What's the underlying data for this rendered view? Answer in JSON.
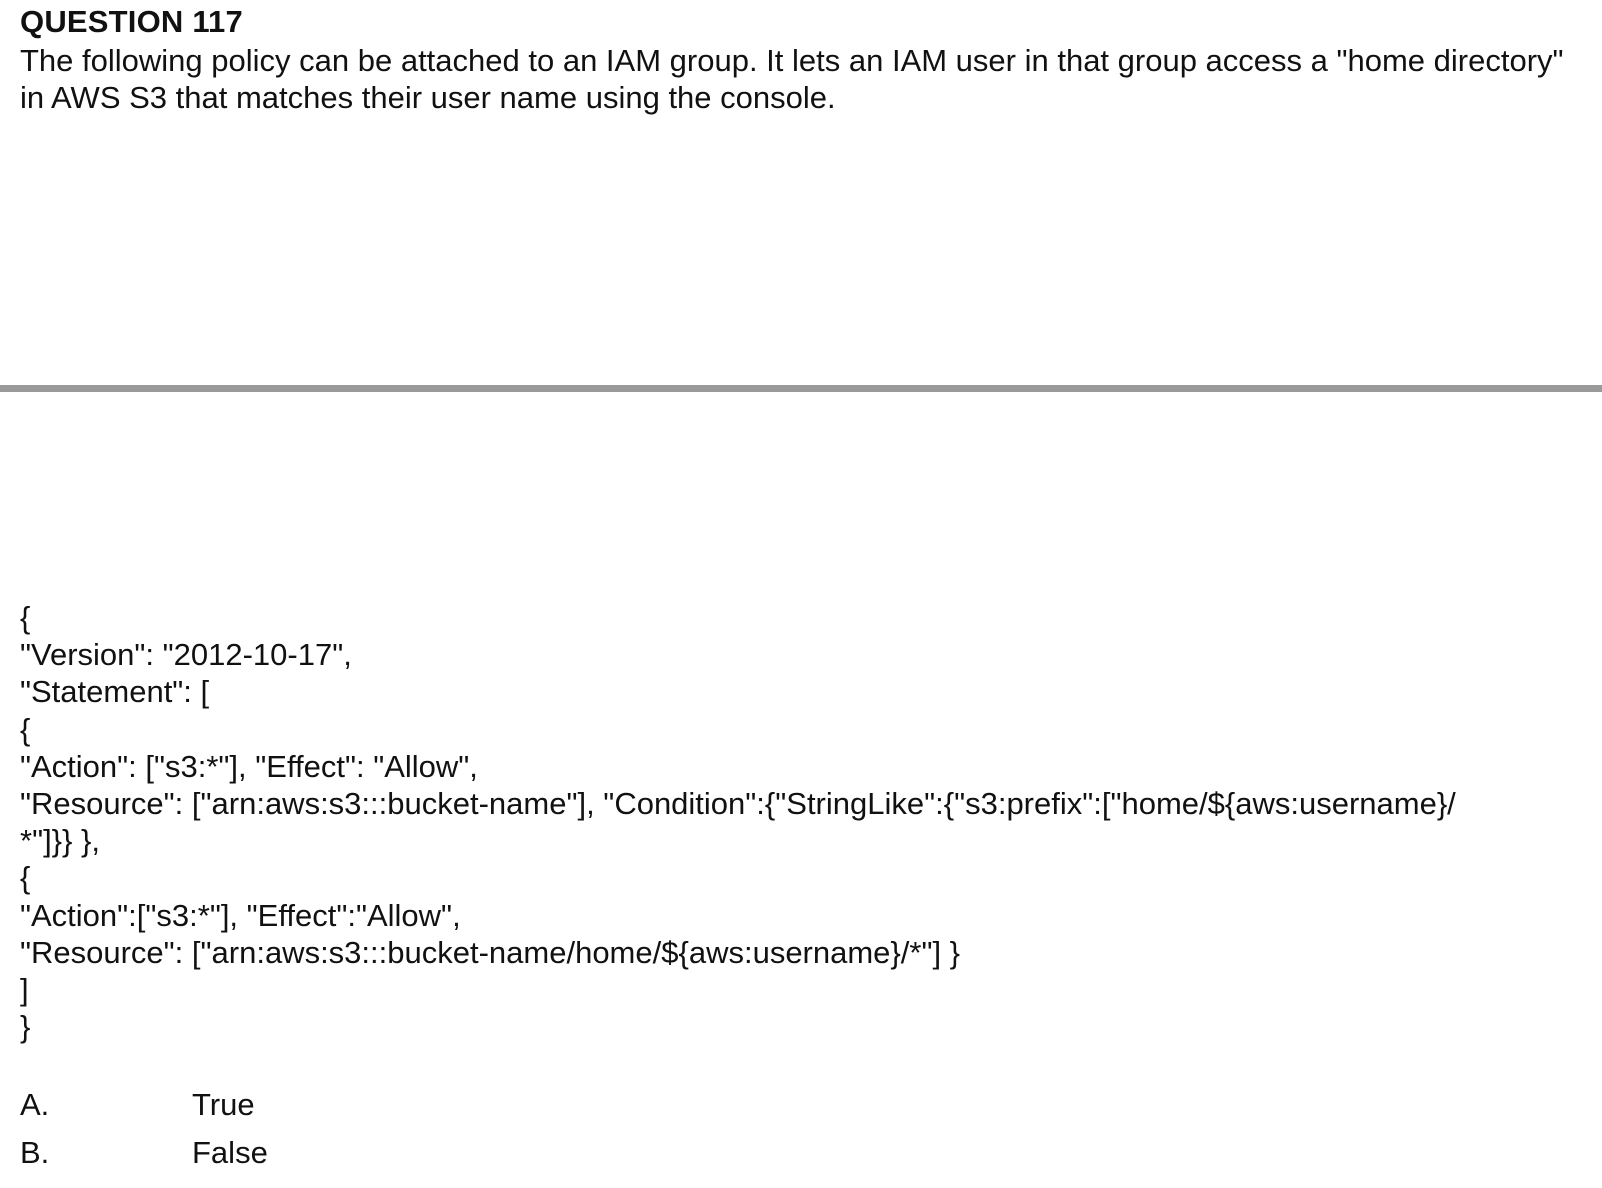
{
  "question": {
    "title": "QUESTION 117",
    "text": "The following policy can be attached to an IAM group. It lets an IAM user in that group access a \"home directory\" in AWS S3 that matches their user name using the console."
  },
  "policy_lines": [
    "{",
    "\"Version\": \"2012-10-17\",",
    "\"Statement\": [",
    "{",
    "\"Action\": [\"s3:*\"], \"Effect\": \"Allow\",",
    "\"Resource\": [\"arn:aws:s3:::bucket-name\"], \"Condition\":{\"StringLike\":{\"s3:prefix\":[\"home/${aws:username}/",
    "*\"]}} },",
    "{",
    "\"Action\":[\"s3:*\"], \"Effect\":\"Allow\",",
    "\"Resource\": [\"arn:aws:s3:::bucket-name/home/${aws:username}/*\"] }",
    "]",
    "}"
  ],
  "options": [
    {
      "letter": "A.",
      "text": "True"
    },
    {
      "letter": "B.",
      "text": "False"
    }
  ]
}
